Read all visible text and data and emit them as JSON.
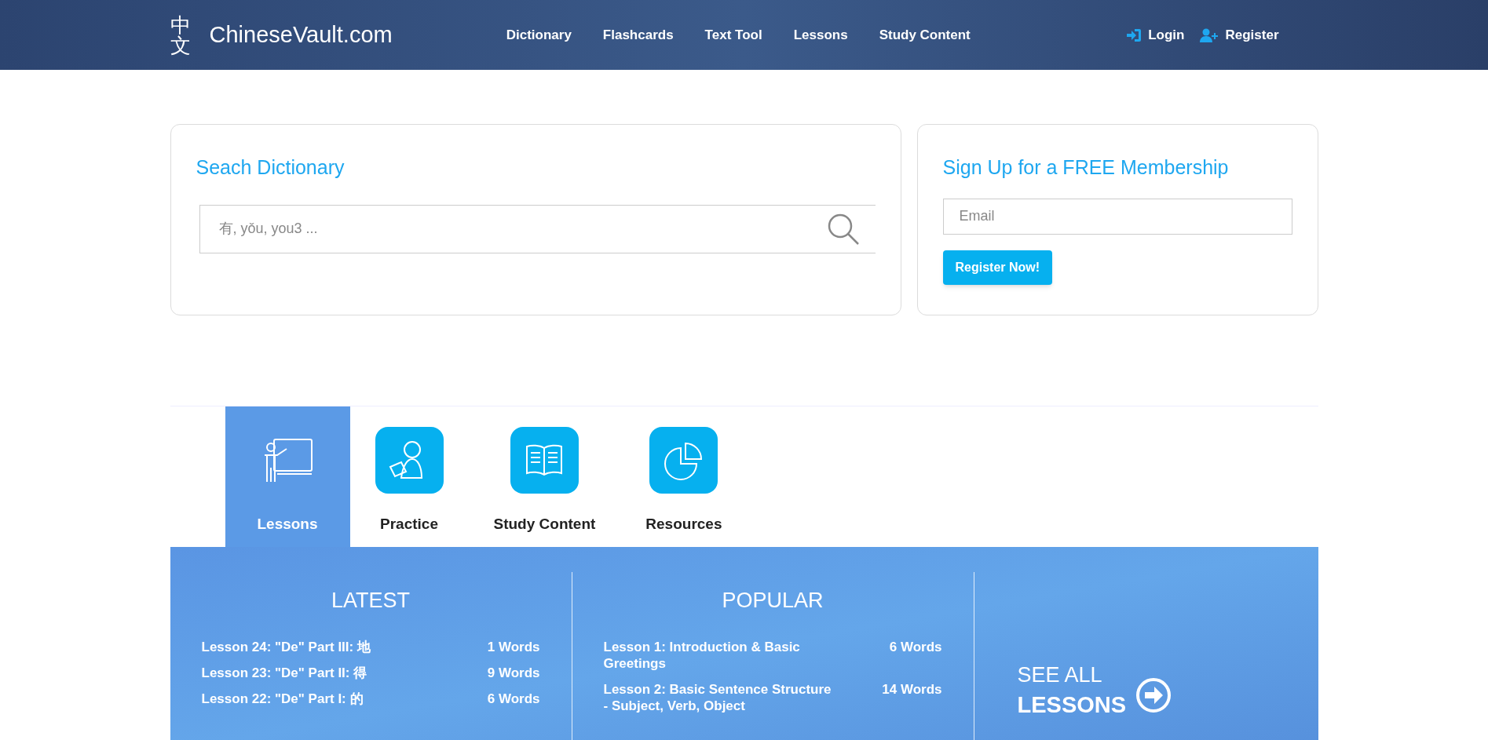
{
  "header": {
    "logo_glyph": "中文",
    "logo_text": "ChineseVault.com",
    "nav": [
      "Dictionary",
      "Flashcards",
      "Text Tool",
      "Lessons",
      "Study Content"
    ],
    "auth": [
      {
        "kind": "login",
        "label": "Login"
      },
      {
        "kind": "register",
        "label": "Register"
      }
    ]
  },
  "search_card": {
    "title": "Seach Dictionary",
    "placeholder": "有, yǒu, you3 ..."
  },
  "signup_card": {
    "title": "Sign Up for a FREE Membership",
    "placeholder": "Email",
    "button": "Register Now!"
  },
  "tabs": [
    {
      "kind": "teacher",
      "label": "Lessons",
      "selected": true
    },
    {
      "kind": "student",
      "label": "Practice",
      "selected": false
    },
    {
      "kind": "book",
      "label": "Study Content",
      "selected": false
    },
    {
      "kind": "pie",
      "label": "Resources",
      "selected": false
    }
  ],
  "latest": {
    "title": "LATEST",
    "items": [
      {
        "name": "Lesson 24: \"De\" Part III: 地",
        "count": "1 Words"
      },
      {
        "name": "Lesson 23: \"De\" Part II: 得",
        "count": "9 Words"
      },
      {
        "name": "Lesson 22: \"De\" Part I: 的",
        "count": "6 Words"
      }
    ]
  },
  "popular": {
    "title": "POPULAR",
    "items": [
      {
        "name": "Lesson 1: Introduction & Basic Greetings",
        "count": "6 Words"
      },
      {
        "name": "Lesson 2: Basic Sentence Structure - Subject, Verb, Object",
        "count": "14 Words"
      }
    ]
  },
  "see_all": {
    "line1": "SEE ALL",
    "line2": "LESSONS"
  }
}
